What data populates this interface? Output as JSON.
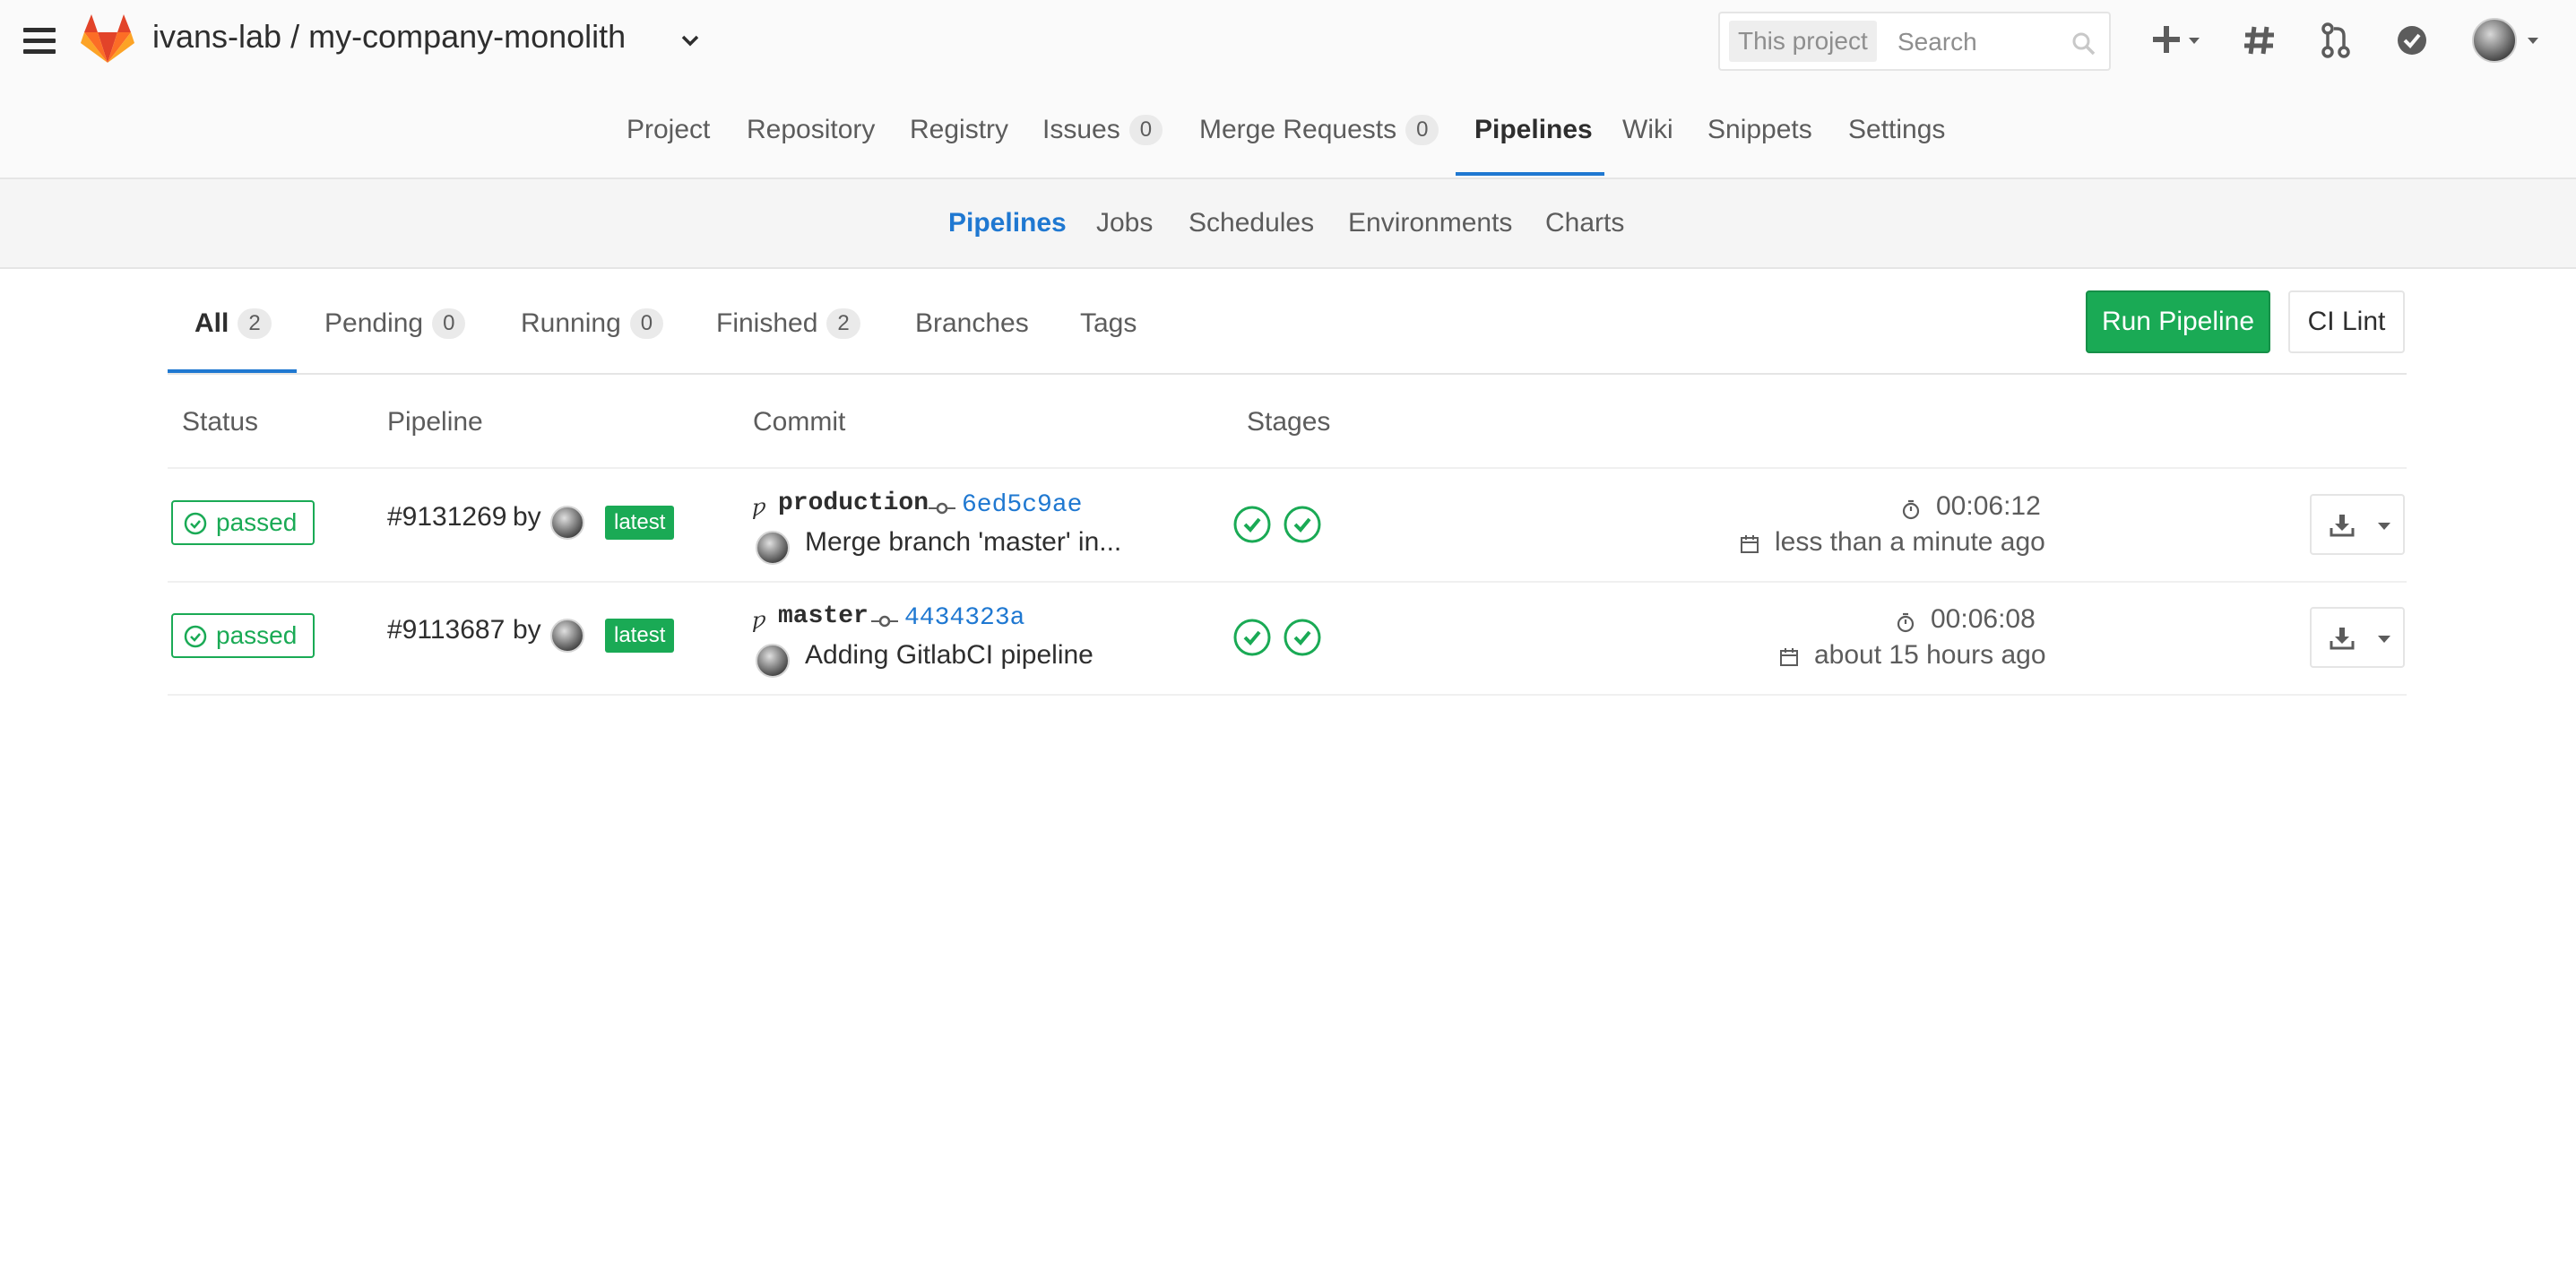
{
  "header": {
    "project_path": "ivans-lab / my-company-monolith",
    "search": {
      "scope": "This project",
      "placeholder": "Search"
    }
  },
  "main_nav": {
    "items": [
      {
        "label": "Project"
      },
      {
        "label": "Repository"
      },
      {
        "label": "Registry"
      },
      {
        "label": "Issues",
        "count": "0"
      },
      {
        "label": "Merge Requests",
        "count": "0"
      },
      {
        "label": "Pipelines",
        "active": true
      },
      {
        "label": "Wiki"
      },
      {
        "label": "Snippets"
      },
      {
        "label": "Settings"
      }
    ]
  },
  "sub_nav": {
    "items": [
      {
        "label": "Pipelines",
        "active": true
      },
      {
        "label": "Jobs"
      },
      {
        "label": "Schedules"
      },
      {
        "label": "Environments"
      },
      {
        "label": "Charts"
      }
    ]
  },
  "scope_tabs": [
    {
      "label": "All",
      "count": "2",
      "active": true
    },
    {
      "label": "Pending",
      "count": "0"
    },
    {
      "label": "Running",
      "count": "0"
    },
    {
      "label": "Finished",
      "count": "2"
    },
    {
      "label": "Branches"
    },
    {
      "label": "Tags"
    }
  ],
  "actions": {
    "run_pipeline": "Run Pipeline",
    "ci_lint": "CI Lint"
  },
  "table": {
    "headers": [
      "Status",
      "Pipeline",
      "Commit",
      "Stages"
    ],
    "rows": [
      {
        "status": "passed",
        "pipeline_id": "#9131269",
        "by": "by",
        "badge": "latest",
        "ref": "production",
        "sha": "6ed5c9ae",
        "message": "Merge branch 'master' in...",
        "stages": [
          "passed",
          "passed"
        ],
        "duration": "00:06:12",
        "finished": "less than a minute ago"
      },
      {
        "status": "passed",
        "pipeline_id": "#9113687",
        "by": "by",
        "badge": "latest",
        "ref": "master",
        "sha": "4434323a",
        "message": "Adding GitlabCI pipeline",
        "stages": [
          "passed",
          "passed"
        ],
        "duration": "00:06:08",
        "finished": "about 15 hours ago"
      }
    ]
  },
  "colors": {
    "success": "#1aaa55",
    "link": "#1f78d1",
    "active_underline": "#1f78d1",
    "logo_orange": "#e24329"
  },
  "icons": [
    "hamburger-icon",
    "gitlab-logo",
    "chevron-down-icon",
    "search-icon",
    "plus-icon",
    "hash-icon",
    "merge-request-icon",
    "todo-check-icon",
    "stopwatch-icon",
    "calendar-icon",
    "download-icon",
    "branch-icon",
    "commit-icon",
    "status-success-icon"
  ]
}
